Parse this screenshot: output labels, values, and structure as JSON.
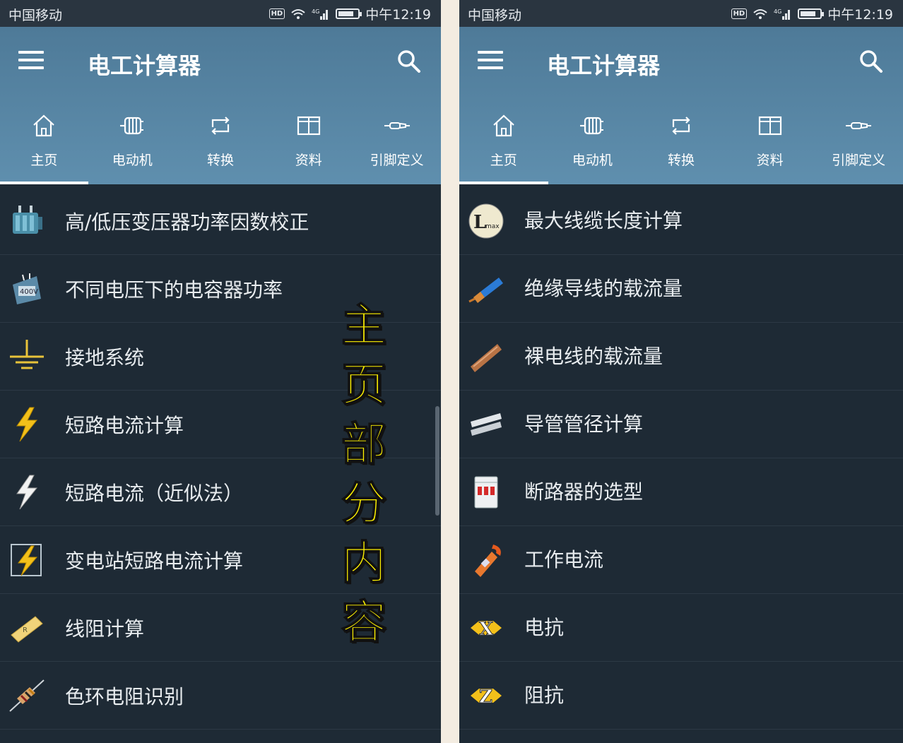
{
  "left": {
    "status": {
      "carrier": "中国移动",
      "time": "中午12:19"
    },
    "title": "电工计算器",
    "tabs": [
      {
        "label": "主页",
        "icon": "home-icon"
      },
      {
        "label": "电动机",
        "icon": "motor-icon"
      },
      {
        "label": "转换",
        "icon": "convert-icon"
      },
      {
        "label": "资料",
        "icon": "book-icon"
      },
      {
        "label": "引脚定义",
        "icon": "pin-icon"
      }
    ],
    "items": [
      {
        "label": "高/低压变压器功率因数校正",
        "icon": "transformer-icon"
      },
      {
        "label": "不同电压下的电容器功率",
        "icon": "capacitor-icon"
      },
      {
        "label": "接地系统",
        "icon": "ground-icon"
      },
      {
        "label": "短路电流计算",
        "icon": "lightning-icon"
      },
      {
        "label": "短路电流（近似法）",
        "icon": "lightning-white-icon"
      },
      {
        "label": "变电站短路电流计算",
        "icon": "substation-lightning-icon"
      },
      {
        "label": "线阻计算",
        "icon": "wire-resistance-icon"
      },
      {
        "label": "色环电阻识别",
        "icon": "resistor-icon"
      }
    ],
    "overlay_text": [
      "主",
      "页",
      "部",
      "分",
      "内",
      "容"
    ]
  },
  "right": {
    "status": {
      "carrier": "中国移动",
      "time": "中午12:19"
    },
    "title": "电工计算器",
    "tabs": [
      {
        "label": "主页",
        "icon": "home-icon"
      },
      {
        "label": "电动机",
        "icon": "motor-icon"
      },
      {
        "label": "转换",
        "icon": "convert-icon"
      },
      {
        "label": "资料",
        "icon": "book-icon"
      },
      {
        "label": "引脚定义",
        "icon": "pin-icon"
      }
    ],
    "items": [
      {
        "label": "最大线缆长度计算",
        "icon": "cable-length-icon"
      },
      {
        "label": "绝缘导线的载流量",
        "icon": "insulated-wire-icon"
      },
      {
        "label": "裸电线的载流量",
        "icon": "bare-wire-icon"
      },
      {
        "label": "导管管径计算",
        "icon": "conduit-icon"
      },
      {
        "label": "断路器的选型",
        "icon": "breaker-icon"
      },
      {
        "label": "工作电流",
        "icon": "clamp-meter-icon"
      },
      {
        "label": "电抗",
        "icon": "reactance-icon"
      },
      {
        "label": "阻抗",
        "icon": "impedance-icon"
      }
    ]
  }
}
